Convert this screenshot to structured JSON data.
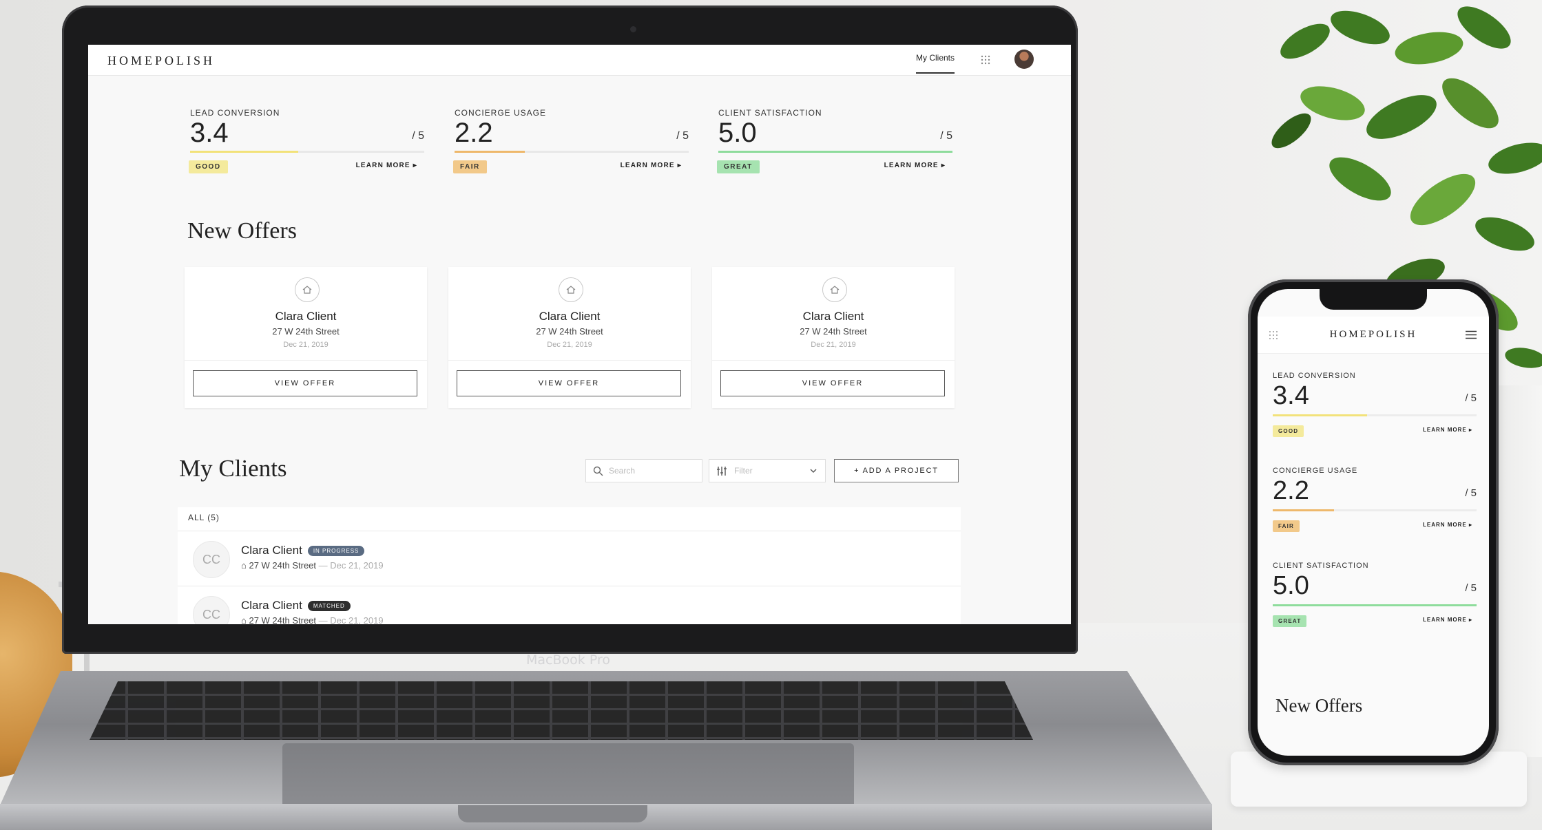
{
  "app": {
    "logo": "HOMEPOLISH",
    "nav_my_clients": "My Clients"
  },
  "metrics": [
    {
      "label": "LEAD CONVERSION",
      "value": "3.4",
      "max": "/ 5",
      "score": 3.4,
      "badge": "GOOD",
      "badge_color": "#f4ea9c",
      "bar_color": "#f2e27a",
      "learn": "LEARN MORE ▸"
    },
    {
      "label": "CONCIERGE USAGE",
      "value": "2.2",
      "max": "/ 5",
      "score": 2.2,
      "badge": "FAIR",
      "badge_color": "#f2c98a",
      "bar_color": "#eeb86b",
      "learn": "LEARN MORE ▸"
    },
    {
      "label": "CLIENT SATISFACTION",
      "value": "5.0",
      "max": "/ 5",
      "score": 5.0,
      "badge": "GREAT",
      "badge_color": "#a6e3b0",
      "bar_color": "#8edc9c",
      "learn": "LEARN MORE ▸"
    }
  ],
  "new_offers": {
    "title": "New Offers",
    "cards": [
      {
        "name": "Clara Client",
        "address": "27 W 24th Street",
        "date": "Dec 21, 2019",
        "button": "VIEW OFFER"
      },
      {
        "name": "Clara Client",
        "address": "27 W 24th Street",
        "date": "Dec 21, 2019",
        "button": "VIEW OFFER"
      },
      {
        "name": "Clara Client",
        "address": "27 W 24th Street",
        "date": "Dec 21, 2019",
        "button": "VIEW OFFER"
      }
    ]
  },
  "my_clients": {
    "title": "My Clients",
    "search_placeholder": "Search",
    "filter_placeholder": "Filter",
    "add_button": "+   ADD A PROJECT",
    "list_header": "ALL (5)",
    "rows": [
      {
        "initials": "CC",
        "name": "Clara Client",
        "status": "IN PROGRESS",
        "status_color": "#5a6b82",
        "address": "27 W 24th Street",
        "date": " — Dec 21, 2019"
      },
      {
        "initials": "CC",
        "name": "Clara Client",
        "status": "MATCHED",
        "status_color": "#2e2e2e",
        "address": "27 W 24th Street",
        "date": " — Dec 21, 2019"
      }
    ]
  },
  "laptop_label": "MacBook Pro",
  "phone": {
    "logo": "HOMEPOLISH",
    "metrics": [
      {
        "label": "LEAD CONVERSION",
        "value": "3.4",
        "max": "/ 5",
        "score": 3.4,
        "badge": "GOOD",
        "badge_color": "#f4ea9c",
        "bar_color": "#f2e27a",
        "learn": "LEARN MORE ▸"
      },
      {
        "label": "CONCIERGE USAGE",
        "value": "2.2",
        "max": "/ 5",
        "score": 2.2,
        "badge": "FAIR",
        "badge_color": "#f2c98a",
        "bar_color": "#eeb86b",
        "learn": "LEARN MORE ▸"
      },
      {
        "label": "CLIENT SATISFACTION",
        "value": "5.0",
        "max": "/ 5",
        "score": 5.0,
        "badge": "GREAT",
        "badge_color": "#a6e3b0",
        "bar_color": "#8edc9c",
        "learn": "LEARN MORE ▸"
      }
    ],
    "section_title": "New Offers"
  }
}
